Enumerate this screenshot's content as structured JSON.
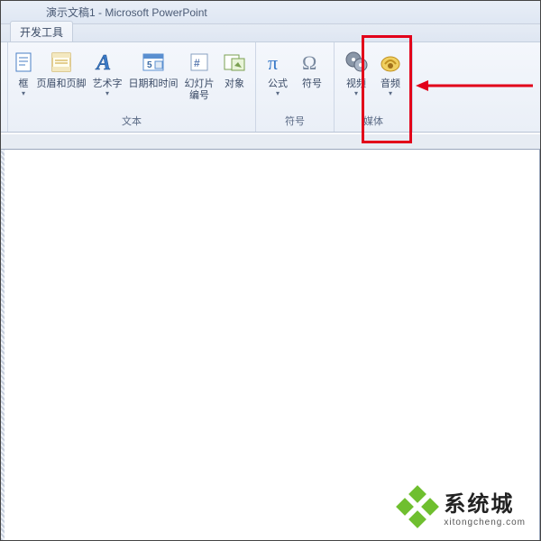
{
  "title": "演示文稿1 - Microsoft PowerPoint",
  "tab": {
    "dev": "开发工具"
  },
  "groups": {
    "text": {
      "label": "文本",
      "buttons": {
        "textbox": "框",
        "headerfooter": "页眉和页脚",
        "wordart": "艺术字",
        "datetime": "日期和时间",
        "slidenum": "幻灯片\n编号",
        "object": "对象"
      }
    },
    "symbols": {
      "label": "符号",
      "buttons": {
        "equation": "公式",
        "symbol": "符号"
      }
    },
    "media": {
      "label": "媒体",
      "buttons": {
        "video": "视频",
        "audio": "音频"
      }
    }
  },
  "watermark": {
    "brand": "系统城",
    "url": "xitongcheng.com"
  }
}
